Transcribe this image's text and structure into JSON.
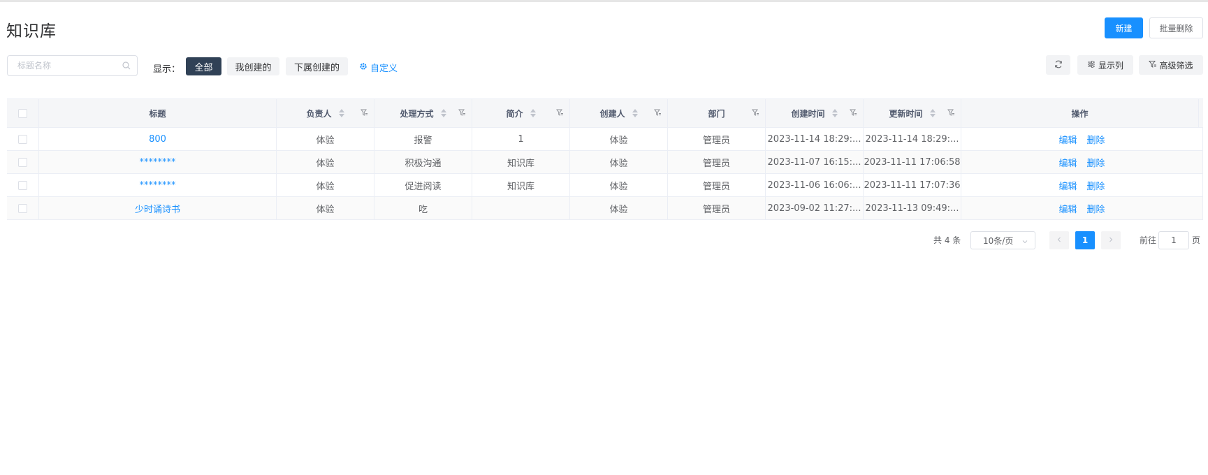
{
  "page": {
    "title": "知识库"
  },
  "header": {
    "new_label": "新建",
    "batch_delete_label": "批量删除"
  },
  "toolbar": {
    "search_placeholder": "标题名称",
    "show_label": "显示：",
    "filters": [
      "全部",
      "我创建的",
      "下属创建的"
    ],
    "active_filter": "全部",
    "custom_label": "自定义",
    "refresh_icon": "refresh-icon",
    "columns_label": "显示列",
    "advanced_filter_label": "高级筛选"
  },
  "table": {
    "columns": [
      "标题",
      "负责人",
      "处理方式",
      "简介",
      "创建人",
      "部门",
      "创建时间",
      "更新时间",
      "操作"
    ],
    "rows": [
      {
        "title": "800",
        "owner": "体验",
        "method": "报警",
        "intro": "1",
        "creator": "体验",
        "dept": "管理员",
        "created": "2023-11-14 18:29:...",
        "updated": "2023-11-14 18:29:..."
      },
      {
        "title": "********",
        "owner": "体验",
        "method": "积极沟通",
        "intro": "知识库",
        "creator": "体验",
        "dept": "管理员",
        "created": "2023-11-07 16:15:...",
        "updated": "2023-11-11 17:06:58"
      },
      {
        "title": "********",
        "owner": "体验",
        "method": "促进阅读",
        "intro": "知识库",
        "creator": "体验",
        "dept": "管理员",
        "created": "2023-11-06 16:06:...",
        "updated": "2023-11-11 17:07:36"
      },
      {
        "title": "少时诵诗书",
        "owner": "体验",
        "method": "吃",
        "intro": "",
        "creator": "体验",
        "dept": "管理员",
        "created": "2023-09-02 11:27:...",
        "updated": "2023-11-13 09:49:..."
      }
    ],
    "edit_label": "编辑",
    "delete_label": "删除"
  },
  "pagination": {
    "total": "共 4 条",
    "page_size": "10条/页",
    "current_page": "1",
    "goto_label": "前往",
    "goto_value": "1",
    "page_suffix": "页"
  },
  "colors": {
    "primary": "#1890ff",
    "dark": "#304156"
  }
}
